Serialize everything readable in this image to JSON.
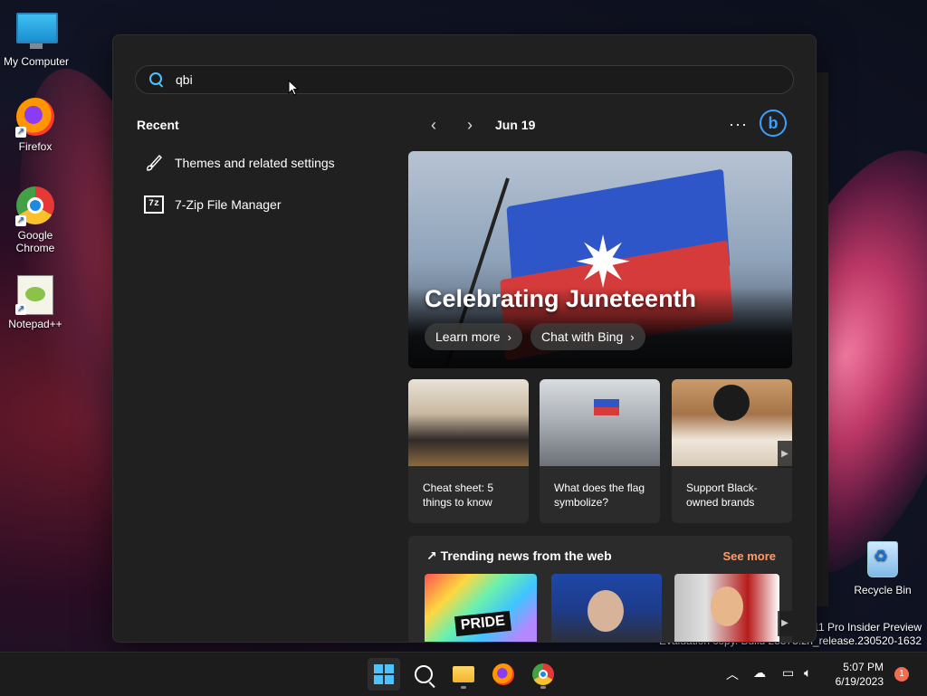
{
  "desktop": {
    "icons": [
      {
        "label": "My Computer",
        "icon": "monitor-icon"
      },
      {
        "label": "Firefox",
        "icon": "firefox-icon"
      },
      {
        "label": "Google Chrome",
        "icon": "chrome-icon"
      },
      {
        "label": "Notepad++",
        "icon": "notepadpp-icon"
      },
      {
        "label": "Recycle Bin",
        "icon": "recycle-bin-icon"
      }
    ],
    "watermark": {
      "line1": "s 11 Pro Insider Preview",
      "line2": "Evaluation copy. Build 25375.zn_release.230520-1632"
    }
  },
  "search": {
    "value": "qbi",
    "icon": "search-icon"
  },
  "recent": {
    "title": "Recent",
    "items": [
      {
        "label": "Themes and related settings",
        "icon": "brush-icon"
      },
      {
        "label": "7-Zip File Manager",
        "icon": "7zip-icon",
        "badge": "7z"
      }
    ]
  },
  "highlights": {
    "date": "Jun 19",
    "more": "···",
    "bing_letter": "b",
    "hero": {
      "title": "Celebrating Juneteenth",
      "learn_more": "Learn more",
      "chat_bing": "Chat with Bing"
    },
    "cards": [
      {
        "text": "Cheat sheet: 5 things to know"
      },
      {
        "text": "What does the flag symbolize?"
      },
      {
        "text": "Support Black-owned brands"
      }
    ],
    "trending": {
      "title": "Trending news from the web",
      "see_more": "See more",
      "thumb_text": "PRIDE"
    }
  },
  "taskbar": {
    "time": "5:07 PM",
    "date": "6/19/2023",
    "notification_count": "1",
    "accent": "#4cc2ff"
  }
}
